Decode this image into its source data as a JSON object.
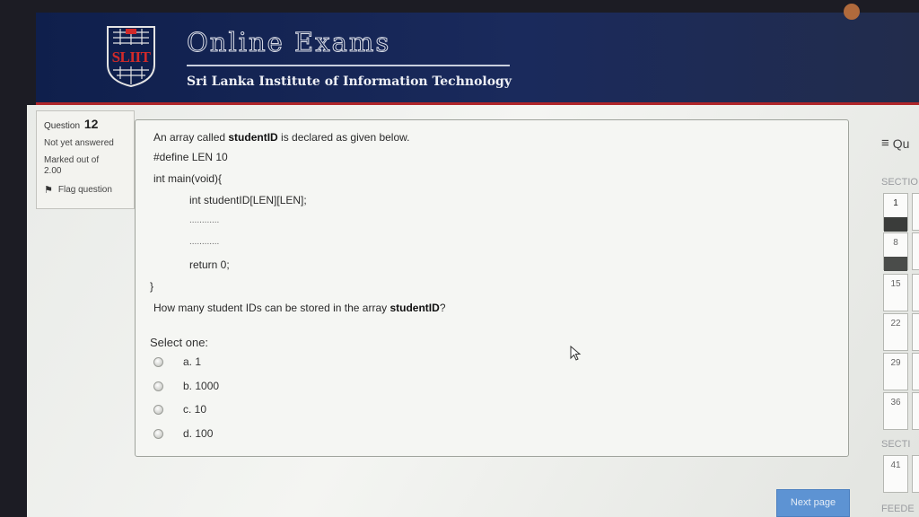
{
  "header": {
    "logo_text": "SLIIT",
    "title": "Online Exams",
    "subtitle": "Sri Lanka Institute of Information Technology"
  },
  "question_info": {
    "label": "Question",
    "number": "12",
    "status": "Not yet answered",
    "marked_label": "Marked out of",
    "marked_value": "2.00",
    "flag_label": "Flag question"
  },
  "question": {
    "line1_pre": "An array called ",
    "line1_bold": "studentID",
    "line1_post": " is declared as given below.",
    "code_define": "#define LEN 10",
    "code_main": "int main(void){",
    "code_decl": "int studentID[LEN][LEN];",
    "code_dots1": "............",
    "code_dots2": "............",
    "code_return": "return 0;",
    "code_close": "}",
    "prompt_pre": "How many student IDs can be stored in the array ",
    "prompt_bold": "studentID",
    "prompt_post": "?",
    "select_label": "Select one:",
    "options": [
      {
        "label": "a. 1"
      },
      {
        "label": "b. 1000"
      },
      {
        "label": "c. 10"
      },
      {
        "label": "d. 100"
      }
    ]
  },
  "next_button": "Next page",
  "quiz_nav": {
    "title": "Qu",
    "section1": "SECTIO",
    "section2": "SECTI",
    "section3": "FEEDE",
    "buttons": [
      "1",
      "8",
      "15",
      "22",
      "29",
      "36",
      "41"
    ]
  },
  "colors": {
    "header_bg": "#0f1f4c",
    "header_accent": "#b0262a",
    "next_button": "#5d93d3"
  }
}
